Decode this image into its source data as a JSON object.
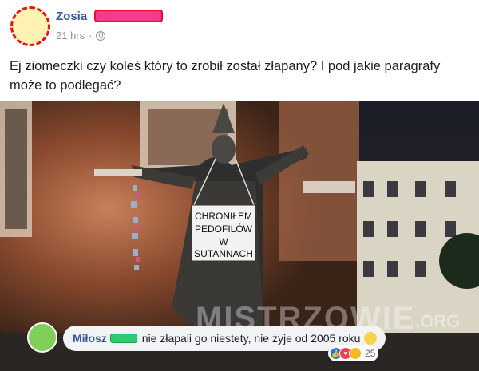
{
  "post": {
    "author": "Zosia",
    "time": "21 hrs",
    "separator": "·",
    "text": "Ej ziomeczki czy koleś który to zrobił został złapany? I pod jakie paragrafy może to podlegać?"
  },
  "photo": {
    "sign_line1": "CHRONIŁEM",
    "sign_line2": "PEDOFILÓW",
    "sign_line3": "W",
    "sign_line4": "SUTANNACH",
    "watermark": "MISTRZOWIE",
    "watermark_domain": ".ORG"
  },
  "comment": {
    "author": "Miłosz",
    "text": "nie złapali go niestety, nie żyje od 2005 roku",
    "reaction_count": "25"
  },
  "colors": {
    "link": "#385898",
    "redaction": "#e8101d"
  }
}
